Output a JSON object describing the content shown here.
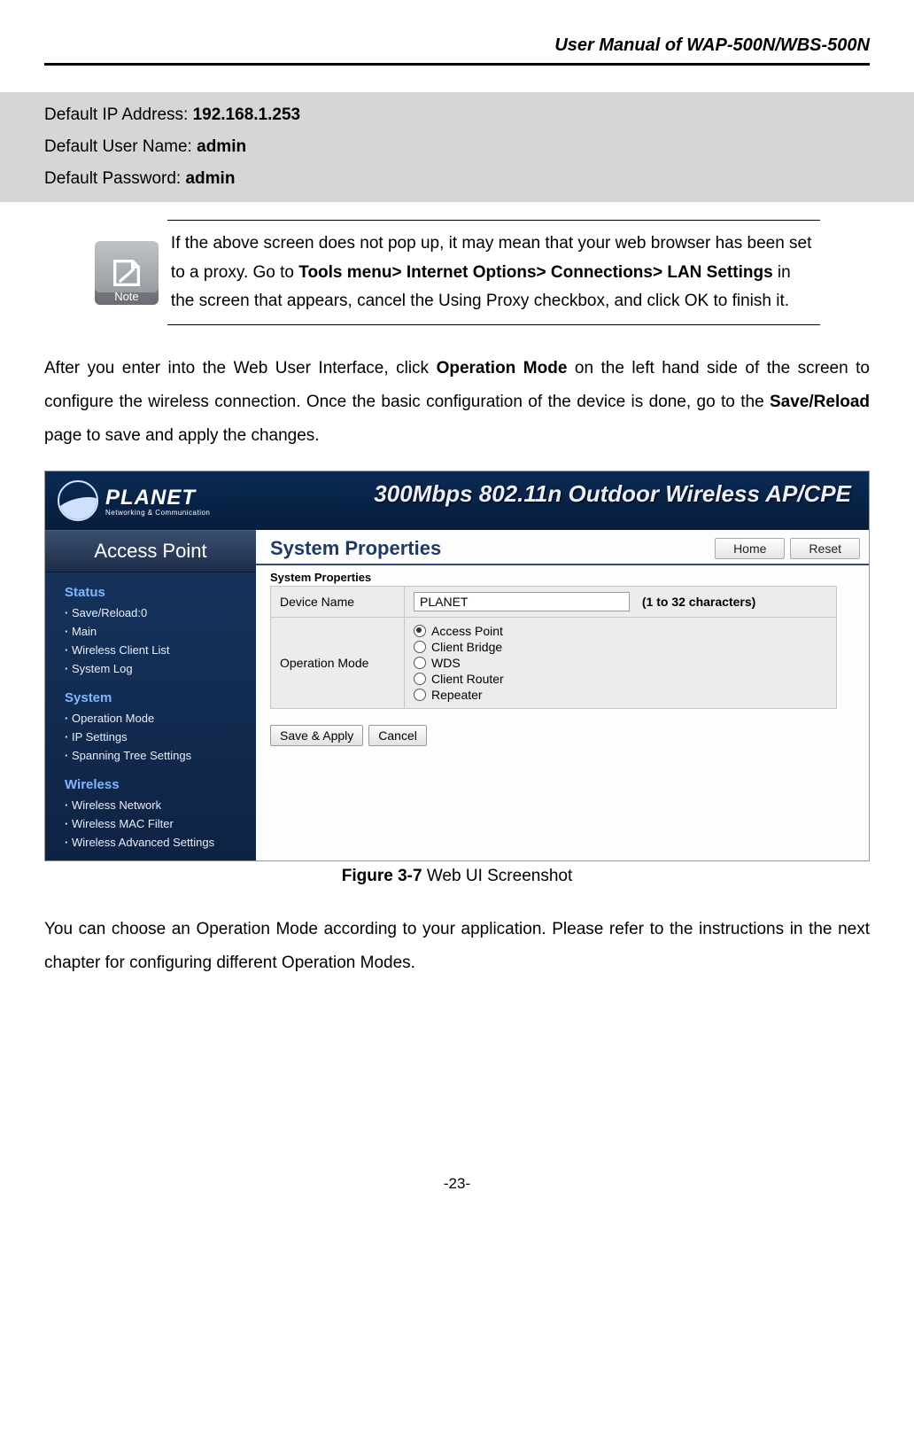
{
  "header_title": "User Manual of WAP-500N/WBS-500N",
  "defaults": {
    "ip_label": "Default IP Address: ",
    "ip_value": "192.168.1.253",
    "user_label": "Default User Name: ",
    "user_value": "admin",
    "pass_label": "Default Password: ",
    "pass_value": "admin"
  },
  "note": {
    "icon_label": "Note",
    "text_pre": "If the above screen does not pop up, it may mean that your web browser has been set to a proxy. Go to ",
    "text_bold": "Tools menu> Internet Options> Connections> LAN Settings",
    "text_post": " in the screen that appears, cancel the Using Proxy checkbox, and click OK to finish it."
  },
  "para1": {
    "a": "After you enter into the Web User Interface, click ",
    "b": "Operation Mode",
    "c": " on the left hand side of the screen to configure the wireless connection. Once the basic configuration of the device is done, go to the ",
    "d": "Save/Reload",
    "e": " page to save and apply the changes."
  },
  "screenshot": {
    "logo_text": "PLANET",
    "logo_sub": "Networking & Communication",
    "banner": "300Mbps 802.11n Outdoor Wireless AP/CPE",
    "side_title": "Access Point",
    "groups": [
      {
        "title": "Status",
        "items": [
          "Save/Reload:0",
          "Main",
          "Wireless Client List",
          "System Log"
        ]
      },
      {
        "title": "System",
        "items": [
          "Operation Mode",
          "IP Settings",
          "Spanning Tree Settings"
        ]
      },
      {
        "title": "Wireless",
        "items": [
          "Wireless Network",
          "Wireless MAC Filter",
          "Wireless Advanced Settings"
        ]
      }
    ],
    "main_title": "System Properties",
    "home_btn": "Home",
    "reset_btn": "Reset",
    "section_label": "System Properties",
    "row_device_label": "Device Name",
    "row_device_value": "PLANET",
    "row_device_hint": "(1 to 32 characters)",
    "row_opmode_label": "Operation Mode",
    "opmodes": [
      "Access Point",
      "Client Bridge",
      "WDS",
      "Client Router",
      "Repeater"
    ],
    "opmode_checked": 0,
    "save_apply_btn": "Save & Apply",
    "cancel_btn": "Cancel"
  },
  "figure": {
    "label": "Figure 3-7",
    "caption": " Web UI Screenshot"
  },
  "para2": "You can choose an Operation Mode according to your application. Please refer to the instructions in the next chapter for configuring different Operation Modes.",
  "page_number": "-23-"
}
